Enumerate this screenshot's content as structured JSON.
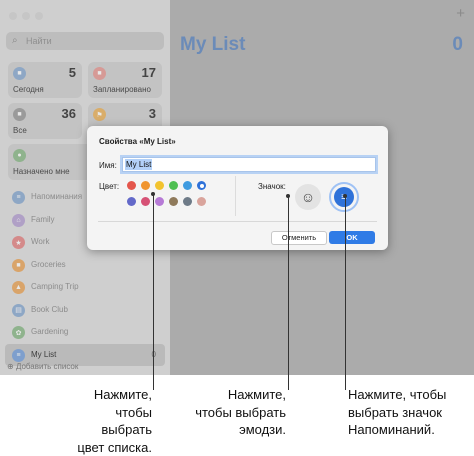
{
  "colors": {
    "traffic": [
      "#c6c6c6",
      "#c6c6c6",
      "#c6c6c6"
    ],
    "accent": "#2f7be6",
    "swatches": [
      "#e4564c",
      "#f0952f",
      "#f2c32f",
      "#4fbf52",
      "#3f9be0",
      "#2f72d9",
      "#6369c9",
      "#d65175",
      "#b67ad6",
      "#8f7a5b",
      "#6e7b88",
      "#d9a49c"
    ],
    "selected_swatch_index": 5
  },
  "sidebar": {
    "search_placeholder": "Найти",
    "smart_lists": [
      {
        "label": "Сегодня",
        "count": "5",
        "icon": "calendar-today-icon",
        "color": "#8ea7c5"
      },
      {
        "label": "Запланировано",
        "count": "17",
        "icon": "calendar-scheduled-icon",
        "color": "#d69a96"
      },
      {
        "label": "Все",
        "count": "36",
        "icon": "tray-icon",
        "color": "#9a9a9a"
      },
      {
        "label": "",
        "count": "3",
        "icon": "flag-icon",
        "color": "#d9ad6a"
      },
      {
        "label": "Назначено мне",
        "count": "",
        "icon": "person-icon",
        "color": "#8fb38d"
      }
    ],
    "my_lists": [
      {
        "label": "Напоминания",
        "count": "",
        "icon": "list-icon",
        "color": "#8ea7c5"
      },
      {
        "label": "Family",
        "count": "",
        "icon": "house-icon",
        "color": "#b0a0c6"
      },
      {
        "label": "Work",
        "count": "",
        "icon": "star-icon",
        "color": "#d48a8a"
      },
      {
        "label": "Groceries",
        "count": "",
        "icon": "cart-icon",
        "color": "#d9a46a"
      },
      {
        "label": "Camping Trip",
        "count": "",
        "icon": "tent-icon",
        "color": "#d9a46a"
      },
      {
        "label": "Book Club",
        "count": "",
        "icon": "book-icon",
        "color": "#8ea7c5"
      },
      {
        "label": "Gardening",
        "count": "",
        "icon": "leaf-icon",
        "color": "#8fb38d"
      },
      {
        "label": "My List",
        "count": "0",
        "icon": "list-icon",
        "color": "#7e9fcd"
      }
    ],
    "add_list": "Добавить список"
  },
  "main": {
    "title": "My List",
    "count": "0",
    "add": "+"
  },
  "dialog": {
    "title": "Свойства «My List»",
    "name_label": "Имя:",
    "name_value": "My List",
    "color_label": "Цвет:",
    "icon_label": "Значок:",
    "cancel": "Отменить",
    "ok": "OK"
  },
  "captions": [
    {
      "line1": "Нажмите,",
      "line2": "чтобы выбрать",
      "line3": "цвет списка."
    },
    {
      "line1": "Нажмите,",
      "line2": "чтобы выбрать",
      "line3": "эмодзи."
    },
    {
      "line1": "Нажмите, чтобы",
      "line2": "выбрать значок",
      "line3": "Напоминаний."
    }
  ]
}
